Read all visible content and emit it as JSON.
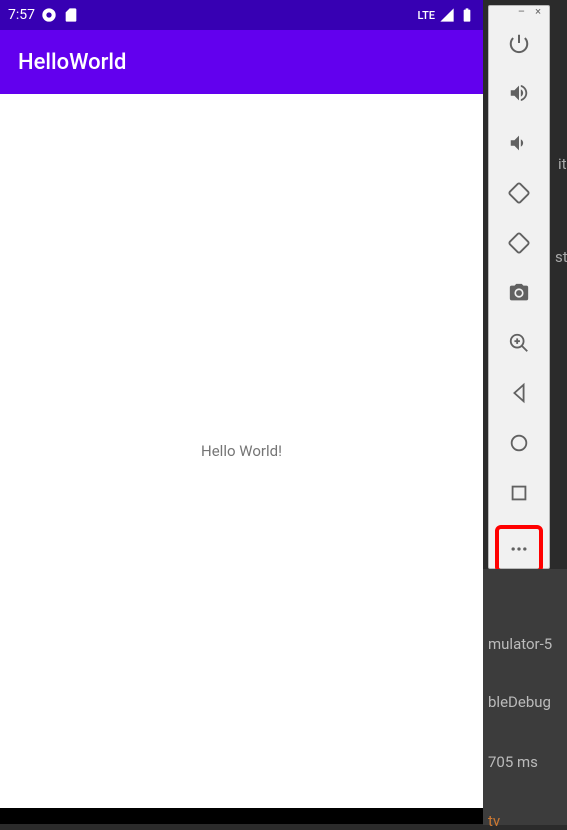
{
  "statusBar": {
    "time": "7:57",
    "networkLabel": "LTE"
  },
  "appBar": {
    "title": "HelloWorld"
  },
  "content": {
    "text": "Hello World!"
  },
  "toolbar": {
    "minimize": "–",
    "close": "×"
  },
  "background": {
    "t1": "it",
    "t2": "st",
    "label1": "mulator-5",
    "label2": "bleDebug",
    "label3": "705 ms",
    "label4": "tv"
  }
}
